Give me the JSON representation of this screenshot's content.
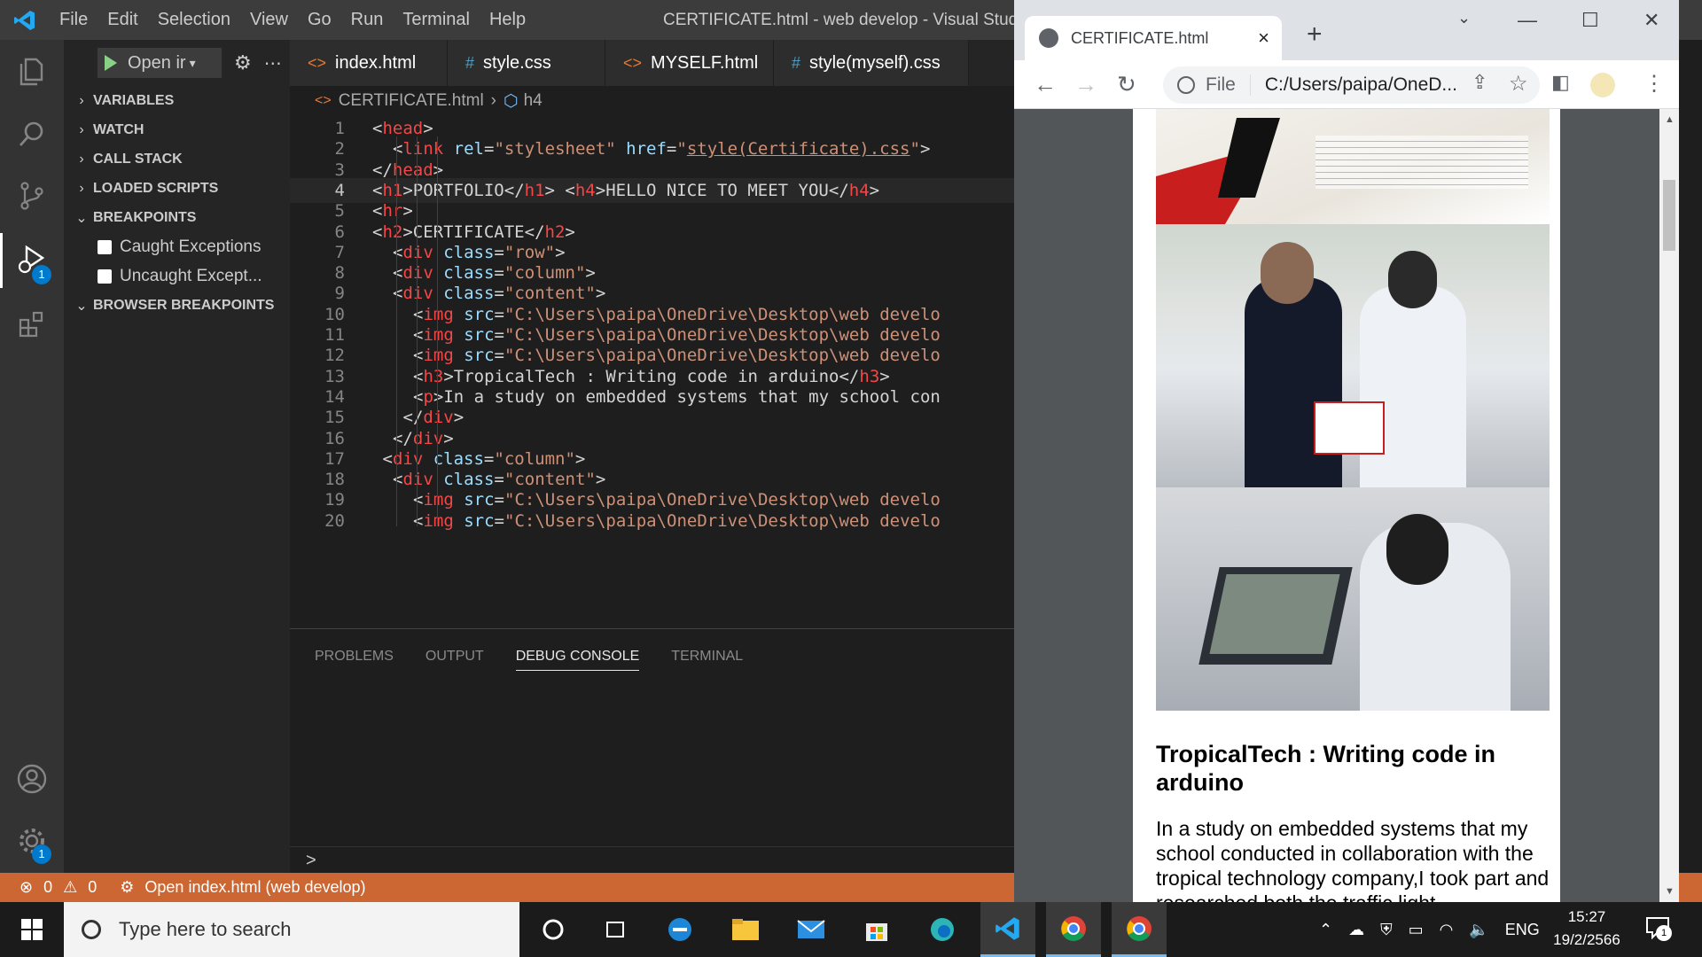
{
  "vscode": {
    "window_title": "CERTIFICATE.html - web develop - Visual Studio Co",
    "menu": [
      "File",
      "Edit",
      "Selection",
      "View",
      "Go",
      "Run",
      "Terminal",
      "Help"
    ],
    "activity_badges": {
      "debug": "1",
      "settings": "1"
    },
    "debug": {
      "run_label": "Open ir",
      "sections": [
        "VARIABLES",
        "WATCH",
        "CALL STACK",
        "LOADED SCRIPTS",
        "BREAKPOINTS"
      ],
      "breakpoints": [
        "Caught Exceptions",
        "Uncaught Except..."
      ],
      "browser_breakpoints": "BROWSER BREAKPOINTS"
    },
    "tabs": [
      {
        "label": "index.html",
        "icon": "<>"
      },
      {
        "label": "style.css",
        "icon": "#"
      },
      {
        "label": "MYSELF.html",
        "icon": "<>"
      },
      {
        "label": "style(myself).css",
        "icon": "#"
      }
    ],
    "breadcrumb": {
      "file": "CERTIFICATE.html",
      "symbol": "h4"
    },
    "code_lines": [
      {
        "n": "1",
        "segs": [
          [
            "br",
            "<"
          ],
          [
            "tag",
            "head"
          ],
          [
            "br",
            ">"
          ]
        ]
      },
      {
        "n": "2",
        "segs": [
          [
            "br",
            "<"
          ],
          [
            "tag",
            "link "
          ],
          [
            "attr",
            "rel"
          ],
          [
            "br",
            "="
          ],
          [
            "str",
            "\"stylesheet\" "
          ],
          [
            "attr",
            "href"
          ],
          [
            "br",
            "="
          ],
          [
            "str",
            "\""
          ],
          [
            "link",
            "style(Certificate).css"
          ],
          [
            "str",
            "\""
          ],
          [
            "br",
            ">"
          ]
        ]
      },
      {
        "n": "3",
        "segs": [
          [
            "br",
            "</"
          ],
          [
            "tag",
            "head"
          ],
          [
            "br",
            ">"
          ]
        ]
      },
      {
        "n": "4",
        "segs": [
          [
            "br",
            "<"
          ],
          [
            "tag",
            "h1"
          ],
          [
            "br",
            ">"
          ],
          [
            "txt",
            "PORTFOLIO"
          ],
          [
            "br",
            "</"
          ],
          [
            "tag",
            "h1"
          ],
          [
            "br",
            "> <"
          ],
          [
            "tag",
            "h4"
          ],
          [
            "br",
            ">"
          ],
          [
            "txt",
            "HELLO NICE TO MEET YOU"
          ],
          [
            "br",
            "</"
          ],
          [
            "tag",
            "h4"
          ],
          [
            "br",
            ">"
          ]
        ]
      },
      {
        "n": "5",
        "segs": [
          [
            "br",
            "<"
          ],
          [
            "tag",
            "hr"
          ],
          [
            "br",
            ">"
          ]
        ]
      },
      {
        "n": "6",
        "segs": [
          [
            "br",
            "<"
          ],
          [
            "tag",
            "h2"
          ],
          [
            "br",
            ">"
          ],
          [
            "txt",
            "CERTIFICATE"
          ],
          [
            "br",
            "</"
          ],
          [
            "tag",
            "h2"
          ],
          [
            "br",
            ">"
          ]
        ]
      },
      {
        "n": "7",
        "segs": [
          [
            "br",
            "<"
          ],
          [
            "tag",
            "div "
          ],
          [
            "attr",
            "class"
          ],
          [
            "br",
            "="
          ],
          [
            "str",
            "\"row\""
          ],
          [
            "br",
            ">"
          ]
        ]
      },
      {
        "n": "8",
        "segs": [
          [
            "br",
            "<"
          ],
          [
            "tag",
            "div "
          ],
          [
            "attr",
            "class"
          ],
          [
            "br",
            "="
          ],
          [
            "str",
            "\"column\""
          ],
          [
            "br",
            ">"
          ]
        ]
      },
      {
        "n": "9",
        "segs": [
          [
            "br",
            "<"
          ],
          [
            "tag",
            "div "
          ],
          [
            "attr",
            "class"
          ],
          [
            "br",
            "="
          ],
          [
            "str",
            "\"content\""
          ],
          [
            "br",
            ">"
          ]
        ]
      },
      {
        "n": "10",
        "segs": [
          [
            "br",
            "<"
          ],
          [
            "tag",
            "img "
          ],
          [
            "attr",
            "src"
          ],
          [
            "br",
            "="
          ],
          [
            "str",
            "\"C:\\Users\\paipa\\OneDrive\\Desktop\\web develo"
          ]
        ]
      },
      {
        "n": "11",
        "segs": [
          [
            "br",
            "<"
          ],
          [
            "tag",
            "img "
          ],
          [
            "attr",
            "src"
          ],
          [
            "br",
            "="
          ],
          [
            "str",
            "\"C:\\Users\\paipa\\OneDrive\\Desktop\\web develo"
          ]
        ]
      },
      {
        "n": "12",
        "segs": [
          [
            "br",
            "<"
          ],
          [
            "tag",
            "img "
          ],
          [
            "attr",
            "src"
          ],
          [
            "br",
            "="
          ],
          [
            "str",
            "\"C:\\Users\\paipa\\OneDrive\\Desktop\\web develo"
          ]
        ]
      },
      {
        "n": "13",
        "segs": [
          [
            "br",
            "<"
          ],
          [
            "tag",
            "h3"
          ],
          [
            "br",
            ">"
          ],
          [
            "txt",
            "TropicalTech : Writing code in arduino"
          ],
          [
            "br",
            "</"
          ],
          [
            "tag",
            "h3"
          ],
          [
            "br",
            ">"
          ]
        ]
      },
      {
        "n": "14",
        "segs": [
          [
            "br",
            "<"
          ],
          [
            "tag",
            "p"
          ],
          [
            "br",
            ">"
          ],
          [
            "txt",
            "In a study on embedded systems that my school con"
          ]
        ]
      },
      {
        "n": "15",
        "segs": [
          [
            "br",
            "</"
          ],
          [
            "tag",
            "div"
          ],
          [
            "br",
            ">"
          ]
        ]
      },
      {
        "n": "16",
        "segs": [
          [
            "br",
            "</"
          ],
          [
            "tag",
            "div"
          ],
          [
            "br",
            ">"
          ]
        ]
      },
      {
        "n": "17",
        "segs": [
          [
            "br",
            "<"
          ],
          [
            "tag",
            "div "
          ],
          [
            "attr",
            "class"
          ],
          [
            "br",
            "="
          ],
          [
            "str",
            "\"column\""
          ],
          [
            "br",
            ">"
          ]
        ]
      },
      {
        "n": "18",
        "segs": [
          [
            "br",
            "<"
          ],
          [
            "tag",
            "div "
          ],
          [
            "attr",
            "class"
          ],
          [
            "br",
            "="
          ],
          [
            "str",
            "\"content\""
          ],
          [
            "br",
            ">"
          ]
        ]
      },
      {
        "n": "19",
        "segs": [
          [
            "br",
            "<"
          ],
          [
            "tag",
            "img "
          ],
          [
            "attr",
            "src"
          ],
          [
            "br",
            "="
          ],
          [
            "str",
            "\"C:\\Users\\paipa\\OneDrive\\Desktop\\web develo"
          ]
        ]
      },
      {
        "n": "20",
        "segs": [
          [
            "br",
            "<"
          ],
          [
            "tag",
            "img "
          ],
          [
            "attr",
            "src"
          ],
          [
            "br",
            "="
          ],
          [
            "str",
            "\"C:\\Users\\paipa\\OneDrive\\Desktop\\web develo"
          ]
        ]
      }
    ],
    "panel_tabs": [
      "PROBLEMS",
      "OUTPUT",
      "DEBUG CONSOLE",
      "TERMINAL"
    ],
    "console_prompt": ">",
    "status": {
      "errors": "0",
      "warnings": "0",
      "launch": "Open index.html (web develop)"
    }
  },
  "chrome": {
    "tab_title": "CERTIFICATE.html",
    "tab_close": "×",
    "new_tab": "+",
    "scheme_label": "File",
    "url": "C:/Users/paipa/OneD...",
    "page": {
      "heading": "TropicalTech : Writing code in arduino",
      "paragraph": "In a study on embedded systems that my school conducted in collaboration with the tropical technology company,I took part and researched both the traffic light"
    }
  },
  "taskbar": {
    "search_placeholder": "Type here to search",
    "language": "ENG",
    "time": "15:27",
    "date": "19/2/2566",
    "notification_count": "1"
  },
  "colors": {
    "accent": "#007acc",
    "statusbar": "#cc6633",
    "tag": "#f44747",
    "attr": "#9cdcfe",
    "string": "#ce9178"
  }
}
